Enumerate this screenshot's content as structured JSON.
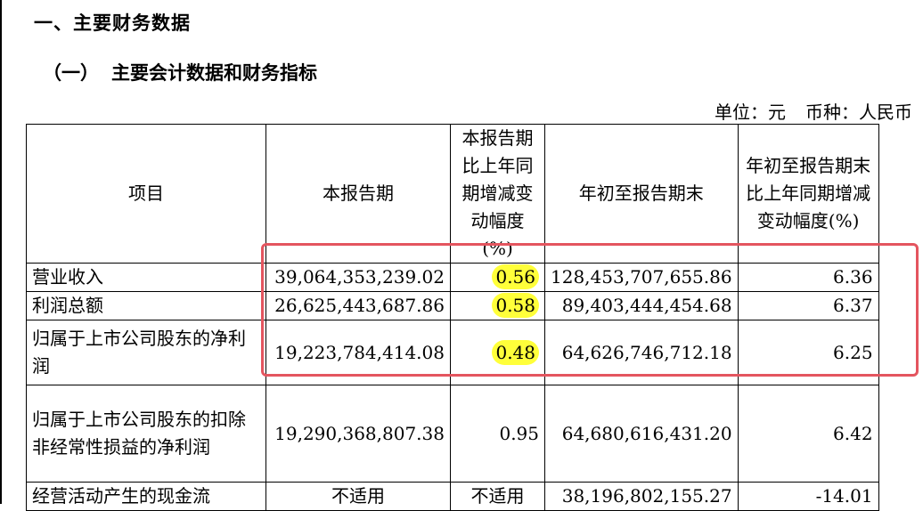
{
  "section_title": "一、主要财务数据",
  "subsection": {
    "number": "（一）",
    "title": "主要会计数据和财务指标"
  },
  "unit_line": {
    "unit": "单位：元",
    "currency": "币种：人民币"
  },
  "table": {
    "headers": [
      "项目",
      "本报告期",
      "本报告期比上年同期增减变动幅度(%)",
      "年初至报告期末",
      "年初至报告期末比上年同期增减变动幅度(%)"
    ],
    "rows": [
      [
        "营业收入",
        "39,064,353,239.02",
        "0.56",
        "128,453,707,655.86",
        "6.36"
      ],
      [
        "利润总额",
        "26,625,443,687.86",
        "0.58",
        "89,403,444,454.68",
        "6.37"
      ],
      [
        "归属于上市公司股东的净利润",
        "19,223,784,414.08",
        "0.48",
        "64,626,746,712.18",
        "6.25"
      ],
      [
        "归属于上市公司股东的扣除非经常性损益的净利润",
        "19,290,368,807.38",
        "0.95",
        "64,680,616,431.20",
        "6.42"
      ],
      [
        "经营活动产生的现金流",
        "不适用",
        "不适用",
        "38,196,802,155.27",
        "-14.01"
      ]
    ]
  },
  "colors": {
    "highlight": "#ffff3a",
    "annotation_box": "#e4555f"
  }
}
